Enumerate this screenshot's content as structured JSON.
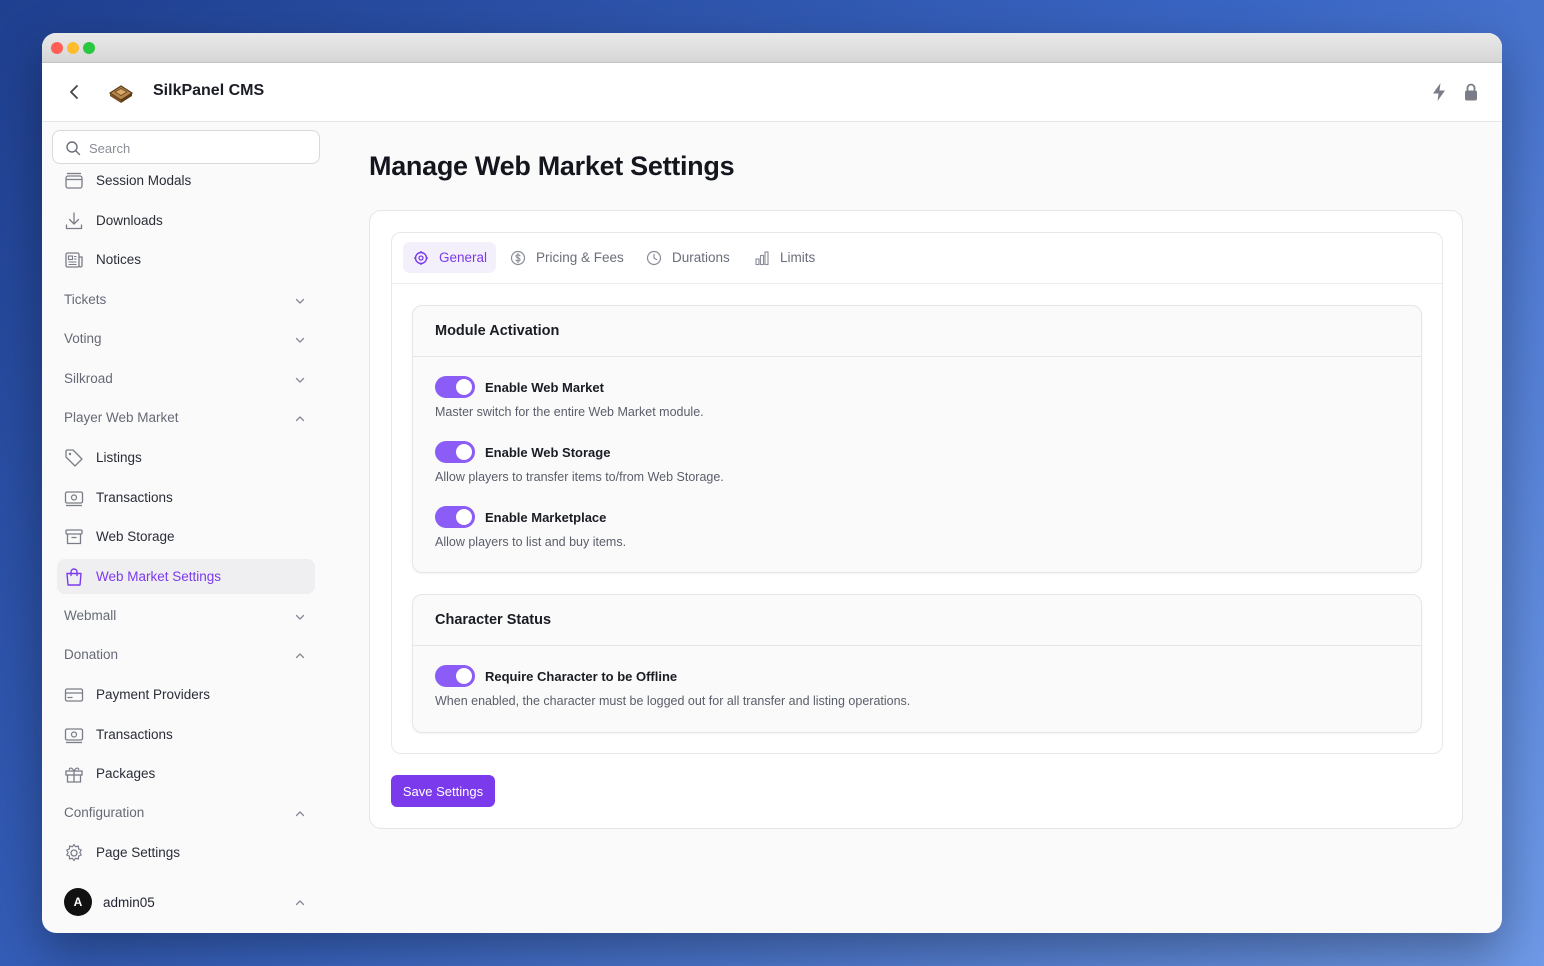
{
  "app": {
    "name": "SilkPanel CMS"
  },
  "search": {
    "placeholder": "Search"
  },
  "sidebar": {
    "items": [
      {
        "label": "Session Modals",
        "icon": "window-icon"
      },
      {
        "label": "Downloads",
        "icon": "download-icon"
      },
      {
        "label": "Notices",
        "icon": "newspaper-icon"
      },
      {
        "label": "Tickets",
        "group": true,
        "expanded": false
      },
      {
        "label": "Voting",
        "group": true,
        "expanded": false
      },
      {
        "label": "Silkroad",
        "group": true,
        "expanded": false
      },
      {
        "label": "Player Web Market",
        "group": true,
        "expanded": true
      },
      {
        "label": "Listings",
        "icon": "tag-icon"
      },
      {
        "label": "Transactions",
        "icon": "banknote-icon"
      },
      {
        "label": "Web Storage",
        "icon": "archive-icon"
      },
      {
        "label": "Web Market Settings",
        "icon": "shopping-bag-icon",
        "active": true
      },
      {
        "label": "Webmall",
        "group": true,
        "expanded": false
      },
      {
        "label": "Donation",
        "group": true,
        "expanded": true
      },
      {
        "label": "Payment Providers",
        "icon": "credit-card-icon"
      },
      {
        "label": "Transactions",
        "icon": "banknote-icon"
      },
      {
        "label": "Packages",
        "icon": "gift-icon"
      },
      {
        "label": "Configuration",
        "group": true,
        "expanded": true
      },
      {
        "label": "Page Settings",
        "icon": "gear-icon"
      }
    ],
    "user": {
      "initial": "A",
      "name": "admin05"
    }
  },
  "main": {
    "title": "Manage Web Market Settings",
    "tabs": [
      {
        "label": "General",
        "icon": "cog-icon",
        "active": true
      },
      {
        "label": "Pricing & Fees",
        "icon": "dollar-circle-icon"
      },
      {
        "label": "Durations",
        "icon": "clock-icon"
      },
      {
        "label": "Limits",
        "icon": "bar-chart-icon"
      }
    ],
    "sections": [
      {
        "title": "Module Activation",
        "options": [
          {
            "label": "Enable Web Market",
            "description": "Master switch for the entire Web Market module.",
            "enabled": true
          },
          {
            "label": "Enable Web Storage",
            "description": "Allow players to transfer items to/from Web Storage.",
            "enabled": true
          },
          {
            "label": "Enable Marketplace",
            "description": "Allow players to list and buy items.",
            "enabled": true
          }
        ]
      },
      {
        "title": "Character Status",
        "options": [
          {
            "label": "Require Character to be Offline",
            "description": "When enabled, the character must be logged out for all transfer and listing operations.",
            "enabled": true
          }
        ]
      }
    ],
    "save_label": "Save Settings"
  },
  "colors": {
    "accent": "#7c3aed",
    "toggle_on": "#8b5cf6"
  }
}
